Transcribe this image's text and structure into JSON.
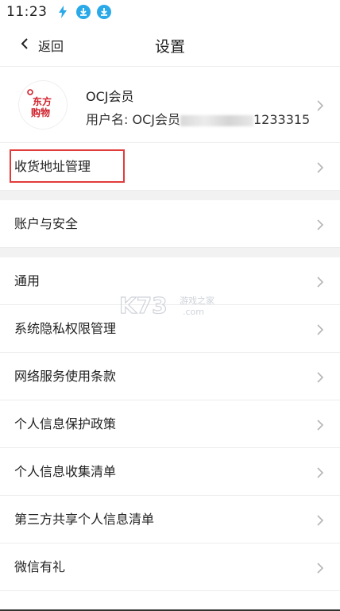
{
  "status_bar": {
    "time": "11:23"
  },
  "nav": {
    "back_label": "返回",
    "title": "设置"
  },
  "profile": {
    "name": "OCJ会员",
    "user_label": "用户名: OCJ会员",
    "user_suffix": "1233315",
    "avatar_text": "东方购物"
  },
  "sections": [
    {
      "items": [
        {
          "label": "收货地址管理",
          "highlighted": true
        }
      ]
    },
    {
      "items": [
        {
          "label": "账户与安全"
        }
      ]
    },
    {
      "items": [
        {
          "label": "通用"
        },
        {
          "label": "系统隐私权限管理"
        },
        {
          "label": "网络服务使用条款"
        },
        {
          "label": "个人信息保护政策"
        },
        {
          "label": "个人信息收集清单"
        },
        {
          "label": "第三方共享个人信息清单"
        },
        {
          "label": "微信有礼"
        }
      ]
    }
  ],
  "watermark": {
    "brand": "K73",
    "line1": "游戏之家",
    "line2": ".com"
  },
  "colors": {
    "highlight": "#e23b3b",
    "icon_blue": "#2aa9e8",
    "divider": "#ececec",
    "gap": "#f2f2f2"
  }
}
